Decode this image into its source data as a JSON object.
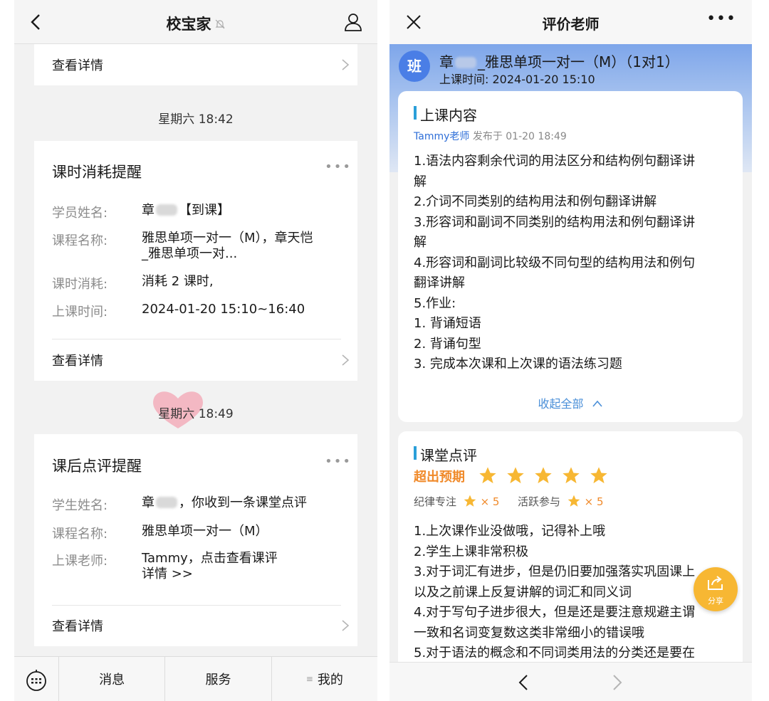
{
  "left": {
    "header": {
      "title": "校宝家"
    },
    "detail_label": "查看详情",
    "time_stamps": [
      "星期六 18:42",
      "星期六 18:49"
    ],
    "card1": {
      "title": "课时消耗提醒",
      "fields": [
        {
          "label": "学员姓名:",
          "value_pre": "章",
          "value_post": "【到课】"
        },
        {
          "label": "课程名称:",
          "value_line1": "雅思单项一对一（M），章天恺",
          "value_line2": "_雅思单项一对..."
        },
        {
          "label": "课时消耗:",
          "value": "消耗 2 课时,"
        },
        {
          "label": "上课时间:",
          "value": "2024-01-20 15:10~16:40"
        }
      ]
    },
    "card2": {
      "title": "课后点评提醒",
      "fields": [
        {
          "label": "学生姓名:",
          "value_pre": "章",
          "value_post": "，你收到一条课堂点评"
        },
        {
          "label": "课程名称:",
          "value": "雅思单项一对一（M）"
        },
        {
          "label": "上课老师:",
          "value_line1": "Tammy，点击查看课评",
          "value_line2": "详情 >>"
        }
      ]
    },
    "bottom_nav": {
      "tabs": [
        "消息",
        "服务",
        "我的"
      ]
    }
  },
  "right": {
    "header": {
      "title": "评价老师"
    },
    "class_badge": "班",
    "class_name_pre": "章",
    "class_name_post": "_雅思单项一对一（M）（1对1）",
    "class_time": "上课时间: 2024-01-20 15:10",
    "content": {
      "title": "上课内容",
      "teacher": "Tammy老师",
      "posted": "发布于 01-20 18:49",
      "lines": [
        "1.语法内容剩余代词的用法区分和结构例句翻译讲",
        "解",
        "2.介词不同类别的结构用法和例句翻译讲解",
        "3.形容词和副词不同类别的结构用法和例句翻译讲",
        "解",
        "4.形容词和副词比较级不同句型的结构用法和例句",
        "翻译讲解",
        "5.作业:",
        "1. 背诵短语",
        "2. 背诵句型",
        "3. 完成本次课和上次课的语法练习题"
      ],
      "collapse": "收起全部"
    },
    "review": {
      "title": "课堂点评",
      "rating_text": "超出预期",
      "rating_stars": 5,
      "sub1_label": "纪律专注",
      "sub1_value": "× 5",
      "sub2_label": "活跃参与",
      "sub2_value": "× 5",
      "lines": [
        "1.上次课作业没做哦，记得补上哦",
        "2.学生上课非常积极",
        "3.对于词汇有进步，但是仍旧要加强落实巩固课上",
        "以及之前课上反复讲解的词汇和同义词",
        "4.对于写句子进步很大，但是还是要注意规避主谓",
        "一致和名词变复数这类非常细小的错误哦",
        "5.对于语法的概念和不同词类用法的分类还是要在"
      ]
    },
    "share_label": "分享",
    "colors": {
      "accent_blue": "#2b9fd9",
      "star": "#f7b733",
      "orange": "#f08a2a"
    }
  }
}
